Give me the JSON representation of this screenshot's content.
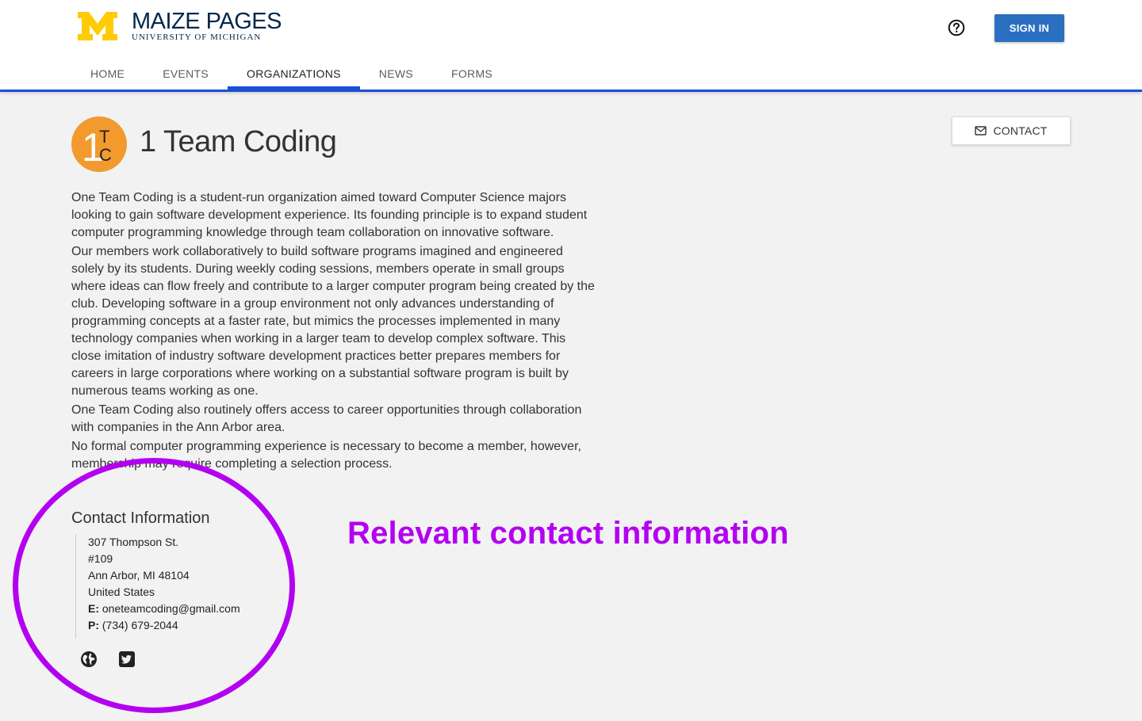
{
  "header": {
    "brand_title": "MAIZE PAGES",
    "brand_subtitle": "UNIVERSITY OF MICHIGAN",
    "help_icon": "question-circle-icon",
    "sign_in_label": "SIGN IN",
    "tabs": [
      {
        "label": "HOME",
        "active": false
      },
      {
        "label": "EVENTS",
        "active": false
      },
      {
        "label": "ORGANIZATIONS",
        "active": true
      },
      {
        "label": "NEWS",
        "active": false
      },
      {
        "label": "FORMS",
        "active": false
      }
    ]
  },
  "colors": {
    "nav_accent": "#1a4fd6",
    "sign_in_bg": "#2b6fc0",
    "brand_navy": "#00274c",
    "maize": "#ffcb05",
    "org_logo_bg": "#f29a2e",
    "annotation": "#b300f0"
  },
  "org": {
    "logo_text": {
      "one": "1",
      "t": "T",
      "c": "C"
    },
    "name": "1 Team Coding",
    "contact_button_label": "CONTACT",
    "contact_icon": "envelope-icon",
    "description": [
      "One Team Coding is a student-run organization aimed toward Computer Science majors looking to gain software development experience. Its founding principle is to expand student computer programming knowledge through team collaboration on innovative software.",
      "Our members work collaboratively to build software programs imagined and engineered solely by its students. During weekly coding sessions, members operate in small groups where ideas can flow freely and contribute to a larger computer program being created by the club. Developing software in a group environment not only advances understanding of programming concepts at a faster rate, but mimics the processes implemented in many technology companies when working in a larger team to develop complex software. This close imitation of industry software development practices better prepares members for careers in large corporations where working on a substantial software program is built by numerous teams working as one.",
      "One Team Coding also routinely offers access to career opportunities through collaboration with companies in the Ann Arbor area.",
      "No formal computer programming experience is necessary to become a member, however, membership may require completing a selection process."
    ]
  },
  "contact": {
    "heading": "Contact Information",
    "address_line1": "307 Thompson St.",
    "address_line2": "#109",
    "address_line3": "Ann Arbor, MI 48104",
    "country": "United States",
    "email_label": "E:",
    "email": "oneteamcoding@gmail.com",
    "phone_label": "P:",
    "phone": "(734) 679-2044",
    "social_icons": [
      "globe-icon",
      "twitter-icon"
    ]
  },
  "annotation": {
    "text": "Relevant contact information"
  }
}
